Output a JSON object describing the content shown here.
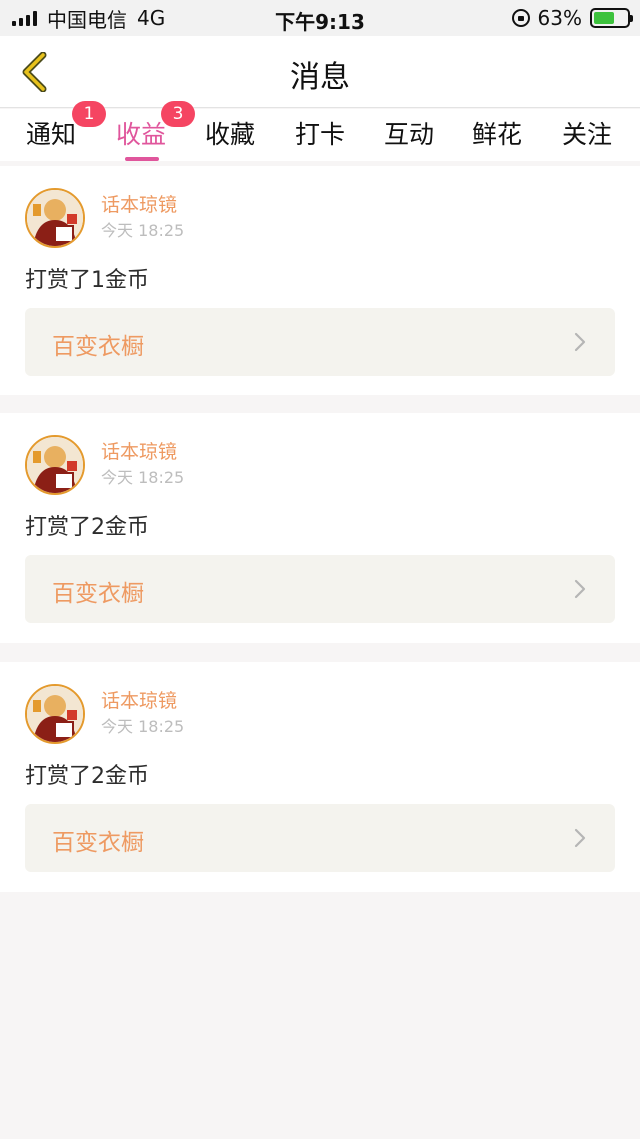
{
  "status_bar": {
    "carrier": "中国电信",
    "network": "4G",
    "time": "下午9:13",
    "battery": "63%",
    "battery_level": 0.63,
    "battery_color": "#3dc23d"
  },
  "nav": {
    "title": "消息",
    "back_icon": "back-chevron-icon"
  },
  "theme": {
    "accent": "#e0569c",
    "author_color": "#ee9a62",
    "badge_color": "#f54562"
  },
  "tabs": [
    {
      "label": "通知",
      "badge": "1"
    },
    {
      "label": "收益",
      "badge": "3",
      "active": true
    },
    {
      "label": "收藏"
    },
    {
      "label": "打卡"
    },
    {
      "label": "互动"
    },
    {
      "label": "鲜花"
    },
    {
      "label": "关注"
    }
  ],
  "feed": [
    {
      "author": "话本琼镜",
      "time": "今天 18:25",
      "message": "打赏了1金币",
      "link": "百变衣橱"
    },
    {
      "author": "话本琼镜",
      "time": "今天 18:25",
      "message": "打赏了2金币",
      "link": "百变衣橱"
    },
    {
      "author": "话本琼镜",
      "time": "今天 18:25",
      "message": "打赏了2金币",
      "link": "百变衣橱"
    }
  ]
}
